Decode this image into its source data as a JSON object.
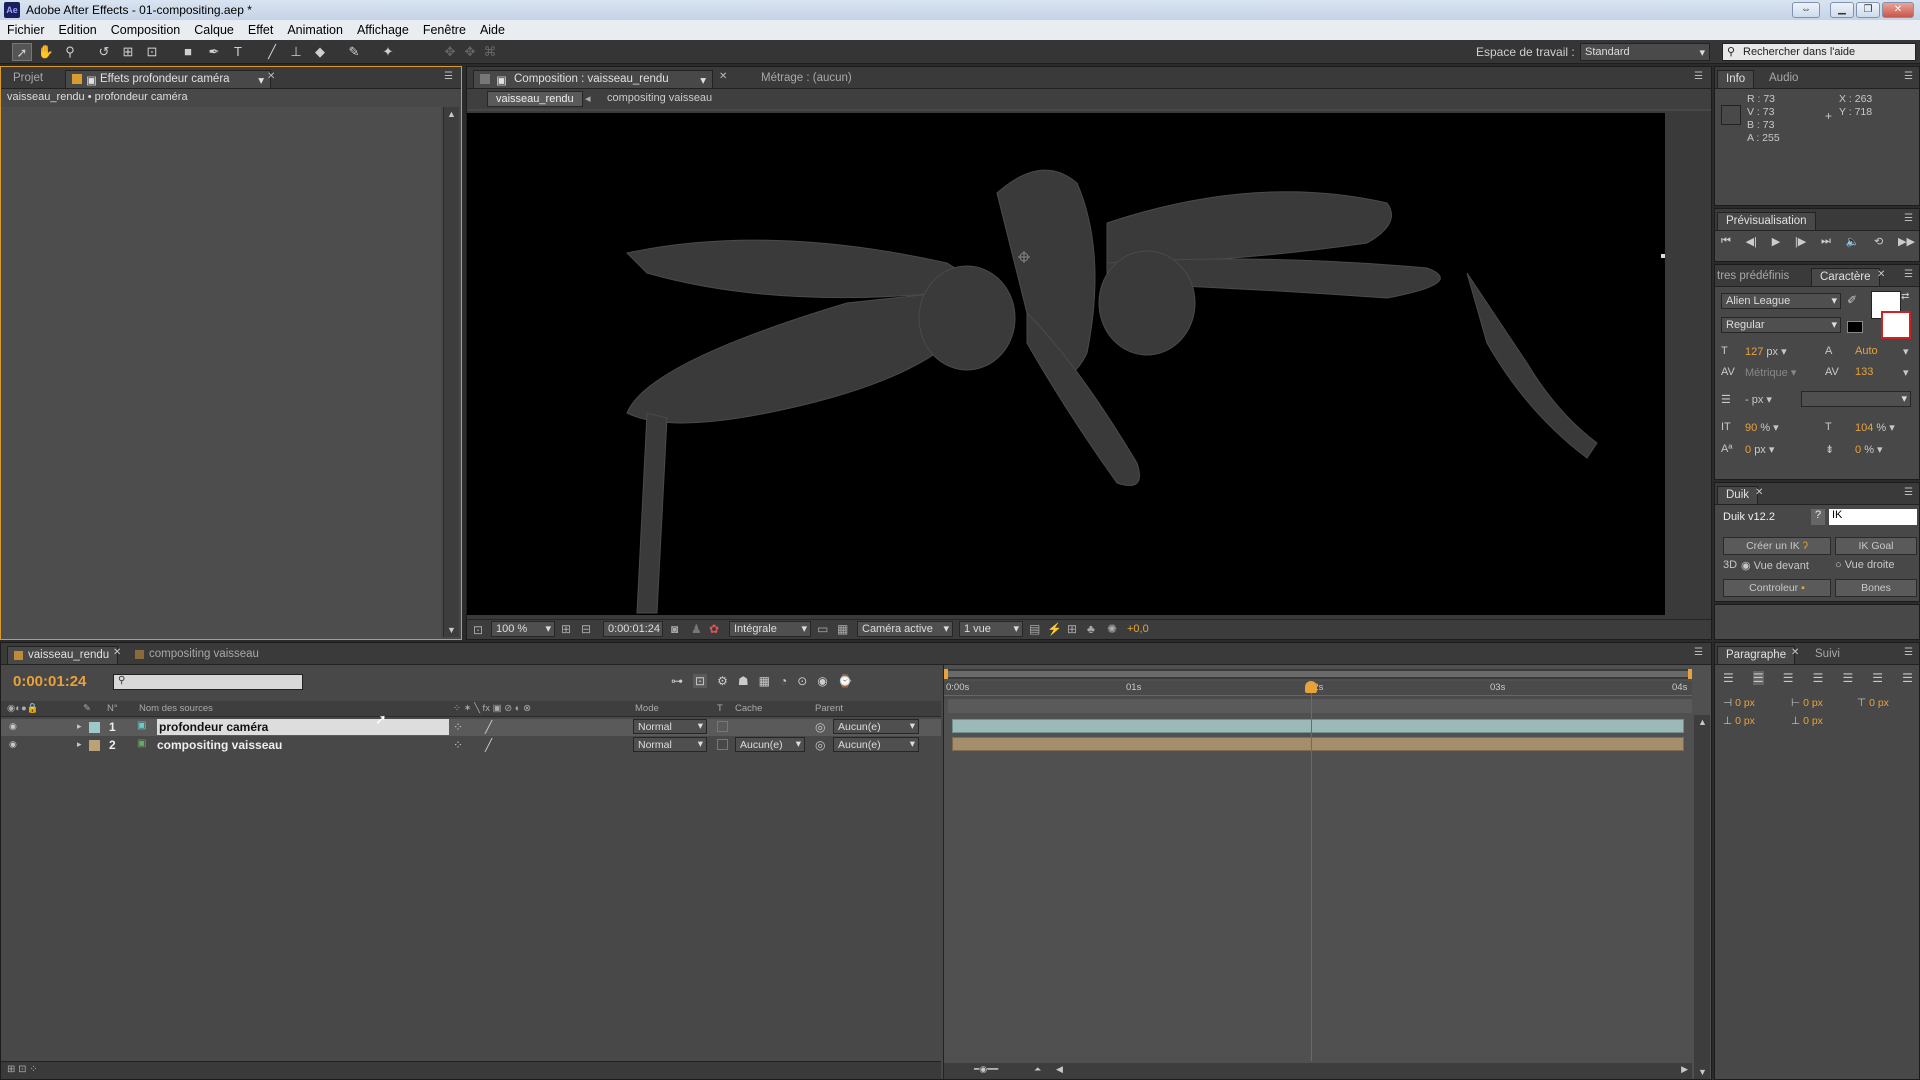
{
  "window": {
    "app_icon": "Ae",
    "title": "Adobe After Effects - 01-compositing.aep *",
    "colors": {
      "titlebar": "#cfdbeb",
      "panel_bg": "#484848",
      "accent": "#e8a23a",
      "playhead": "#ff2a2a"
    }
  },
  "menu": [
    "Fichier",
    "Edition",
    "Composition",
    "Calque",
    "Effet",
    "Animation",
    "Affichage",
    "Fenêtre",
    "Aide"
  ],
  "toolbar": {
    "icons": [
      "selection-tool-icon",
      "hand-tool-icon",
      "zoom-tool-icon",
      "rotate-tool-icon",
      "camera-orbit-icon",
      "pan-behind-icon",
      "rectangle-tool-icon",
      "pen-tool-icon",
      "text-tool-icon",
      "brush-tool-icon",
      "clone-stamp-icon",
      "eraser-icon",
      "roto-brush-icon",
      "puppet-pin-icon"
    ],
    "workspace_label": "Espace de travail :",
    "workspace_value": "Standard",
    "search_placeholder": "Rechercher dans l'aide"
  },
  "project_panel": {
    "tab_project": "Projet",
    "tab_effects": "Effets profondeur caméra",
    "breadcrumb": "vaisseau_rendu • profondeur caméra"
  },
  "comp_panel": {
    "tab_comp": "Composition : vaisseau_rendu",
    "tab_footage": "Métrage : (aucun)",
    "nav_current": "vaisseau_rendu",
    "nav_arrow": "◂",
    "nav_parent": "compositing vaisseau",
    "zoom": "100 %",
    "timecode": "0:00:01:24",
    "resolution": "Intégrale",
    "camera": "Caméra active",
    "views": "1 vue",
    "exposure": "+0,0"
  },
  "info_panel": {
    "tab_info": "Info",
    "tab_audio": "Audio",
    "r": "R : 73",
    "v": "V : 73",
    "b": "B : 73",
    "a": "A : 255",
    "x": "X : 263",
    "y": "Y : 718",
    "swatch_color": "#494949"
  },
  "preview_panel": {
    "tab": "Prévisualisation"
  },
  "character_panel": {
    "tab_presets": "tres prédéfinis",
    "tab_character": "Caractère",
    "font": "Alien League",
    "style": "Regular",
    "size": "127",
    "size_unit": "px",
    "leading": "Auto",
    "kerning": "Métrique",
    "tracking": "133",
    "stroke_unit": "px",
    "vscale": "90",
    "hscale": "104",
    "baseline": "0",
    "baseline_unit": "px",
    "tsume": "0",
    "percent": "%"
  },
  "duik_panel": {
    "tab": "Duik",
    "version": "Duik v12.2",
    "help": "?",
    "field": "IK",
    "btn_create_ik": "Créer un IK",
    "btn_ik_goal": "IK Goal",
    "label_3d": "3D",
    "radio_front": "Vue devant",
    "radio_right": "Vue droite",
    "btn_controller": "Controleur",
    "btn_bones": "Bones"
  },
  "timeline": {
    "tab_active": "vaisseau_rendu",
    "tab_other": "compositing vaisseau",
    "timecode": "0:00:01:24",
    "col_num": "N°",
    "col_source": "Nom des sources",
    "col_mode": "Mode",
    "col_t": "T",
    "col_cache": "Cache",
    "col_parent": "Parent",
    "ruler": [
      "0:00s",
      "01s",
      "02s",
      "03s",
      "04s"
    ],
    "playhead_seconds": 1.96,
    "duration_seconds": 4,
    "layers": [
      {
        "num": "1",
        "name": "profondeur caméra",
        "mode": "Normal",
        "cache": "",
        "parent": "Aucun(e)",
        "label_color": "#9ec9c9",
        "bar_color": "#9bb9b7",
        "selected": true
      },
      {
        "num": "2",
        "name": "compositing vaisseau",
        "mode": "Normal",
        "cache": "Aucun(e)",
        "parent": "Aucun(e)",
        "label_color": "#b9a27a",
        "bar_color": "#a58e6b",
        "selected": false
      }
    ]
  },
  "paragraph_panel": {
    "tab_paragraph": "Paragraphe",
    "tab_track": "Suivi",
    "indent_left": "0 px",
    "indent_right": "0 px",
    "indent_first": "0 px",
    "space_before": "0 px",
    "space_after": "0 px"
  }
}
